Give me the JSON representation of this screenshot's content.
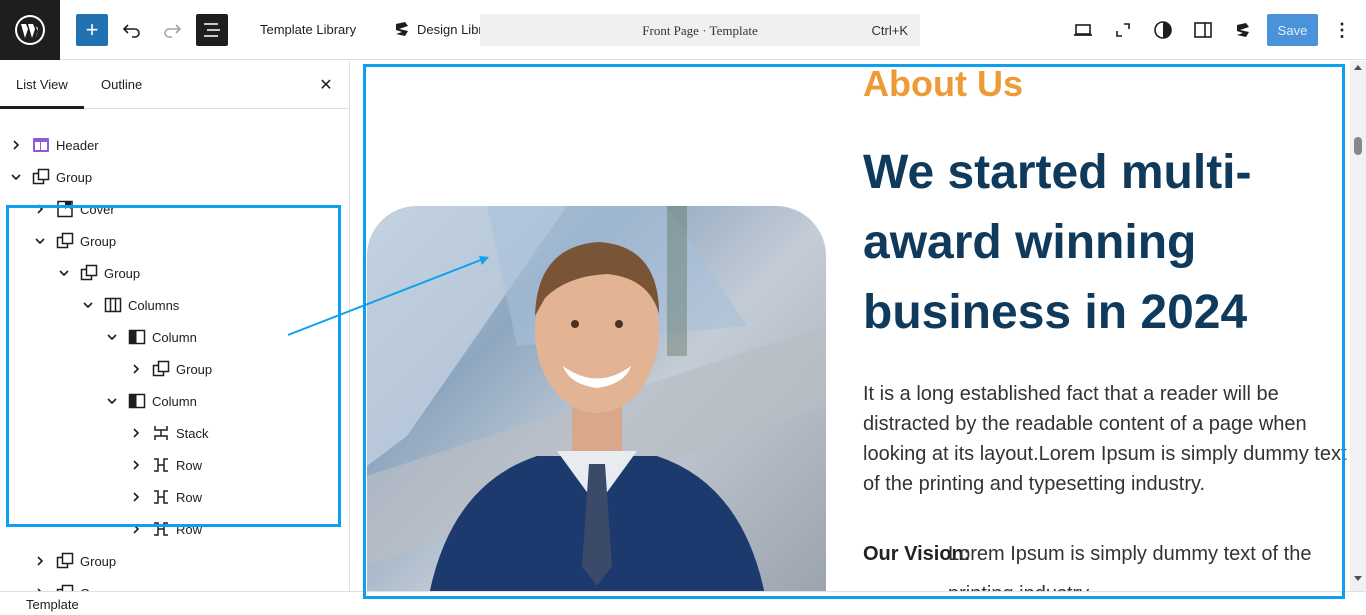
{
  "toolbar": {
    "template_library": "Template Library",
    "design_library": "Design Library",
    "document_title": "Front Page · Template",
    "shortcut": "Ctrl+K",
    "save": "Save",
    "more": "⋮"
  },
  "sidebar": {
    "tabs": [
      "List View",
      "Outline"
    ],
    "close": "✕",
    "tree": [
      {
        "label": "Header",
        "icon": "template-part-icon",
        "state": "collapsed"
      },
      {
        "label": "Group",
        "icon": "group-icon",
        "state": "expanded"
      },
      {
        "label": "Cover",
        "icon": "cover-icon",
        "state": "collapsed"
      },
      {
        "label": "Group",
        "icon": "group-icon",
        "state": "expanded"
      },
      {
        "label": "Group",
        "icon": "group-icon",
        "state": "expanded"
      },
      {
        "label": "Columns",
        "icon": "columns-icon",
        "state": "expanded"
      },
      {
        "label": "Column",
        "icon": "column-icon",
        "state": "expanded"
      },
      {
        "label": "Group",
        "icon": "group-icon",
        "state": "collapsed"
      },
      {
        "label": "Column",
        "icon": "column-icon",
        "state": "expanded"
      },
      {
        "label": "Stack",
        "icon": "stack-icon",
        "state": "collapsed"
      },
      {
        "label": "Row",
        "icon": "row-icon",
        "state": "collapsed"
      },
      {
        "label": "Row",
        "icon": "row-icon",
        "state": "collapsed"
      },
      {
        "label": "Row",
        "icon": "row-icon",
        "state": "collapsed"
      },
      {
        "label": "Group",
        "icon": "group-icon",
        "state": "collapsed"
      },
      {
        "label": "Group",
        "icon": "group-icon",
        "state": "collapsed"
      }
    ]
  },
  "canvas": {
    "about": "About Us",
    "heading": "We started multi-award winning business in 2024",
    "paragraph": "It is a long established fact that a reader will be distracted by the readable content of a page when looking at its layout.Lorem Ipsum is simply dummy text of the printing and typesetting industry.",
    "vision_label": "Our Vision:",
    "vision_text": "Lorem Ipsum is simply dummy text of the printing industry"
  },
  "footer": {
    "breadcrumb": "Template"
  },
  "colors": {
    "accent_orange": "#ee9a36",
    "heading_navy": "#0f3a5c",
    "highlight_blue": "#0ea0f0",
    "wp_blue": "#2271b1"
  }
}
